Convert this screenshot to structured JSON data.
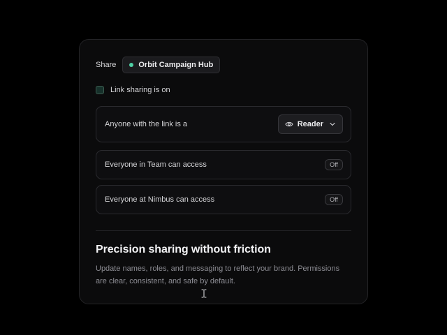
{
  "header": {
    "share_label": "Share",
    "project_name": "Orbit Campaign Hub"
  },
  "link_sharing": {
    "label": "Link sharing is on",
    "checked": true
  },
  "permissions": {
    "anyone_text": "Anyone with the link is a",
    "role_value": "Reader",
    "team_text": "Everyone in Team can access",
    "team_state": "Off",
    "nimbus_text": "Everyone at Nimbus can access",
    "nimbus_state": "Off"
  },
  "footer": {
    "headline": "Precision sharing without friction",
    "subtext": "Update names, roles, and messaging to reflect your brand. Permissions are clear, consistent, and safe by default."
  },
  "colors": {
    "accent": "#4fd1a5",
    "card_bg": "#0b0b0c",
    "page_bg": "#000000"
  },
  "icons": [
    "eye-icon",
    "chevron-down-icon",
    "text-cursor-icon"
  ]
}
